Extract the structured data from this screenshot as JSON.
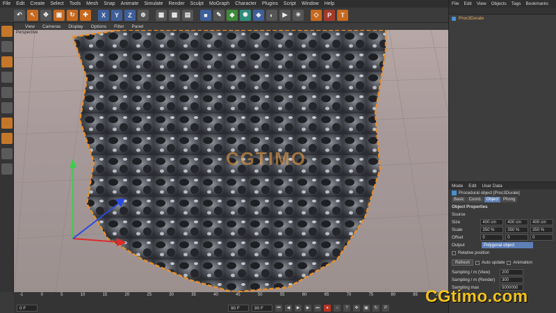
{
  "menu": [
    "File",
    "Edit",
    "Create",
    "Select",
    "Tools",
    "Mesh",
    "Snap",
    "Animate",
    "Simulate",
    "Render",
    "Sculpt",
    "MoGraph",
    "Character",
    "Plugins",
    "Script",
    "Window",
    "Help"
  ],
  "toolbar_axes": [
    "X",
    "Y",
    "Z"
  ],
  "viewport_menu": [
    "View",
    "Cameras",
    "Display",
    "Options",
    "Filter",
    "Panel"
  ],
  "viewport_title": "Perspective",
  "watermark_center": "CGTIMO",
  "timeline": {
    "ticks": [
      "-1",
      "0",
      "5",
      "10",
      "15",
      "20",
      "25",
      "30",
      "35",
      "40",
      "45",
      "50",
      "55",
      "60",
      "65",
      "70",
      "75",
      "80",
      "85",
      "90"
    ],
    "start_field": "0 F",
    "current_field": "90 F",
    "end_field": "90 F"
  },
  "objects_panel": {
    "menu": [
      "File",
      "Edit",
      "View",
      "Objects",
      "Tags",
      "Bookmarks"
    ],
    "objects": [
      "Proc3Durale"
    ]
  },
  "attributes_panel": {
    "menu": [
      "Mode",
      "Edit",
      "User Data"
    ],
    "object_title": "Procedural object [Proc3Durale]",
    "tabs": [
      "Basic",
      "Coord.",
      "Object",
      "Phong"
    ],
    "active_tab": "Object",
    "section_title": "Object Properties",
    "source_label": "Source",
    "size": {
      "label": "Size",
      "values": [
        "400 cm",
        "400 cm",
        "400 cm"
      ]
    },
    "scale": {
      "label": "Scale",
      "values": [
        "350 %",
        "350 %",
        "350 %"
      ]
    },
    "offset": {
      "label": "Offset",
      "values": [
        "0",
        "0",
        "0"
      ]
    },
    "output": {
      "label": "Output",
      "value": "Polygonal object"
    },
    "relative_position_label": "Relative position",
    "refresh_label": "Refresh",
    "auto_update_label": "Auto update",
    "animation_label": "Animation",
    "sampling_view": {
      "label": "Sampling / m (View)",
      "value": "200"
    },
    "sampling_render": {
      "label": "Sampling / m (Render)",
      "value": "300"
    },
    "sampling_max": {
      "label": "Sampling max",
      "value": "5000000"
    }
  },
  "brand_watermark": "CGtimo.com",
  "colors": {
    "accent": "#5e7fb6",
    "object_highlight": "#f0b060",
    "brand": "#f1c21b"
  }
}
